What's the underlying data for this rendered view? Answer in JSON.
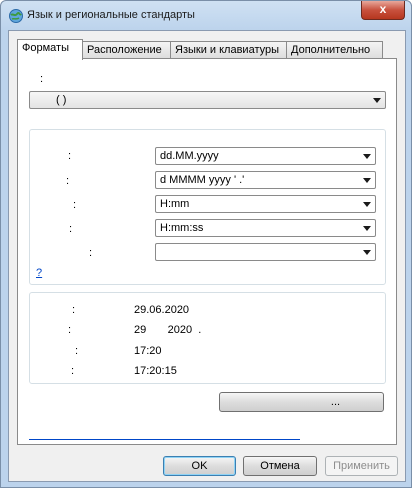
{
  "window": {
    "title": "Язык и региональные стандарты",
    "close_glyph": "x"
  },
  "tabs": [
    {
      "label": "Форматы",
      "active": true
    },
    {
      "label": "Расположение",
      "active": false
    },
    {
      "label": "Языки и клавиатуры",
      "active": false
    },
    {
      "label": "Дополнительно",
      "active": false
    }
  ],
  "format_section": {
    "label": ":",
    "format_value": "(      )"
  },
  "date_time_formats": {
    "rows": [
      {
        "label": ":",
        "value": "dd.MM.yyyy"
      },
      {
        "label": ":",
        "value": "d MMMM yyyy ' .'"
      },
      {
        "label": ":",
        "value": "H:mm"
      },
      {
        "label": ":",
        "value": "H:mm:ss"
      },
      {
        "label": ":",
        "value": ""
      }
    ],
    "link": "                ?"
  },
  "examples": {
    "rows": [
      {
        "label": ":",
        "value": "29.06.2020"
      },
      {
        "label": ":",
        "value": "29       2020  ."
      },
      {
        "label": ":",
        "value": "17:20"
      },
      {
        "label": ":",
        "value": "17:20:15"
      }
    ]
  },
  "additional_button": "...",
  "bottom_link": "",
  "buttons": {
    "ok": "OK",
    "cancel": "Отмена",
    "apply": "Применить"
  },
  "colors": {
    "link": "#0046c8",
    "title_bg": "#bcd3ec",
    "close": "#c8513e"
  }
}
